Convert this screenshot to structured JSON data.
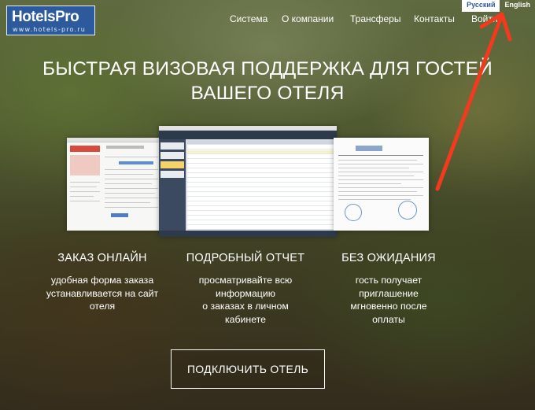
{
  "logo": {
    "name": "HotelsPro",
    "url": "www.hotels-pro.ru",
    "bg_color": "#2c5a9c"
  },
  "language": {
    "options": [
      "Русский",
      "English"
    ],
    "selected": "Русский"
  },
  "nav": {
    "items": [
      "Система",
      "О компании",
      "Трансферы",
      "Контакты",
      "Войти"
    ]
  },
  "hero": {
    "title_line1": "БЫСТРАЯ ВИЗОВАЯ ПОДДЕРЖКА ДЛЯ ГОСТЕЙ",
    "title_line2": "ВАШЕГО ОТЕЛЯ"
  },
  "features": [
    {
      "title": "ЗАКАЗ ОНЛАЙН",
      "lines": [
        "удобная форма заказа",
        "устанавливается на сайт",
        "отеля"
      ]
    },
    {
      "title": "ПОДРОБНЫЙ ОТЧЕТ",
      "lines": [
        "просматривайте всю",
        "информацию",
        "о заказах в личном",
        "кабинете"
      ]
    },
    {
      "title": "БЕЗ ОЖИДАНИЯ",
      "lines": [
        "гость получает",
        "приглашение",
        "мгновенно после",
        "оплаты"
      ]
    }
  ],
  "cta": {
    "label": "ПОДКЛЮЧИТЬ ОТЕЛЬ"
  },
  "annotation": {
    "arrow_color": "#f23a1e"
  }
}
